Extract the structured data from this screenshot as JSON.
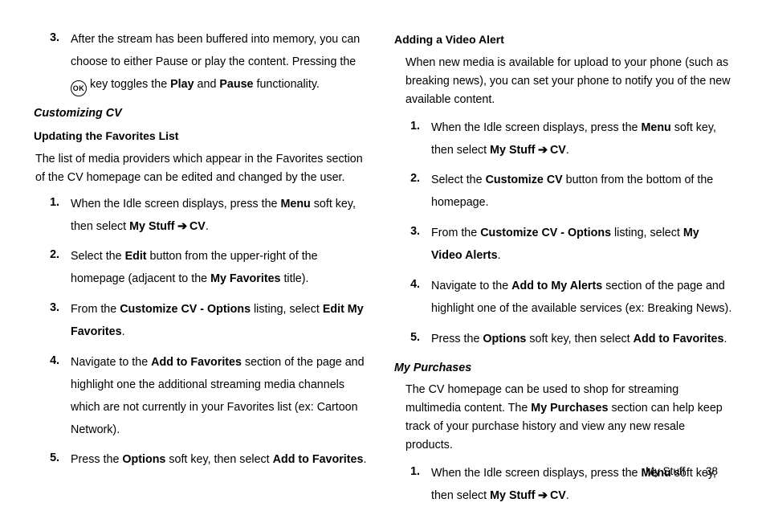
{
  "left": {
    "prior_step_num": "3.",
    "prior_step_text_a": "After the stream has been buffered into memory, you can choose to either Pause or play the content. Pressing the ",
    "prior_step_text_b": " key toggles the ",
    "prior_step_play": "Play",
    "prior_step_and": " and ",
    "prior_step_pause": "Pause",
    "prior_step_text_c": " functionality.",
    "h1": "Customizing CV",
    "h1_sub": "Updating the Favorites List",
    "intro": "The list of media providers which appear in the Favorites section of the CV homepage can be edited and changed by the user.",
    "steps": [
      {
        "n": "1.",
        "pre": "When the Idle screen displays, press the ",
        "b1": "Menu",
        "mid1": " soft key, then select ",
        "b2": "My Stuff",
        "arrow": " ➔ ",
        "b3": "CV",
        "tail": "."
      },
      {
        "n": "2.",
        "pre": "Select the ",
        "b1": "Edit",
        "mid1": " button from the upper-right of the homepage (adjacent to the ",
        "b2": "My Favorites",
        "mid2": " title).",
        "b3": "",
        "arrow": "",
        "tail": ""
      },
      {
        "n": "3.",
        "pre": "From the ",
        "b1": "Customize CV - Options",
        "mid1": " listing, select ",
        "b2": "Edit My Favorites",
        "mid2": ".",
        "b3": "",
        "arrow": "",
        "tail": ""
      },
      {
        "n": "4.",
        "pre": "Navigate to the ",
        "b1": "Add to Favorites",
        "mid1": " section of the page and highlight one the additional streaming media channels which are not currently in your Favorites list (ex: Cartoon Network).",
        "b2": "",
        "mid2": "",
        "b3": "",
        "arrow": "",
        "tail": ""
      },
      {
        "n": "5.",
        "pre": "Press the ",
        "b1": "Options",
        "mid1": " soft key, then select ",
        "b2": "Add to Favorites",
        "mid2": ".",
        "b3": "",
        "arrow": "",
        "tail": ""
      }
    ]
  },
  "right": {
    "h_sub": "Adding a Video Alert",
    "intro": "When new media is available for upload to your phone (such as breaking news), you can set your phone to notify you of the new available content.",
    "steps": [
      {
        "n": "1.",
        "pre": "When the Idle screen displays, press the ",
        "b1": "Menu",
        "mid1": " soft key, then select ",
        "b2": "My Stuff",
        "arrow": " ➔ ",
        "b3": "CV",
        "tail": "."
      },
      {
        "n": "2.",
        "pre": "Select the ",
        "b1": "Customize CV",
        "mid1": " button from the bottom of the homepage.",
        "b2": "",
        "mid2": "",
        "b3": "",
        "arrow": "",
        "tail": ""
      },
      {
        "n": "3.",
        "pre": "From the ",
        "b1": "Customize CV - Options",
        "mid1": " listing, select ",
        "b2": "My Video Alerts",
        "mid2": ".",
        "b3": "",
        "arrow": "",
        "tail": ""
      },
      {
        "n": "4.",
        "pre": "Navigate to the ",
        "b1": "Add to My Alerts",
        "mid1": " section of the page and highlight one of the available services (ex: Breaking News).",
        "b2": "",
        "mid2": "",
        "b3": "",
        "arrow": "",
        "tail": ""
      },
      {
        "n": "5.",
        "pre": "Press the ",
        "b1": "Options",
        "mid1": " soft key, then select ",
        "b2": "Add to Favorites",
        "mid2": ".",
        "b3": "",
        "arrow": "",
        "tail": ""
      }
    ],
    "h2": "My Purchases",
    "intro2_a": "The CV homepage can be used to shop for streaming multimedia content. The ",
    "intro2_b": "My Purchases",
    "intro2_c": " section can help keep track of your purchase history and view any new resale products.",
    "steps2": [
      {
        "n": "1.",
        "pre": "When the Idle screen displays, press the ",
        "b1": "Menu",
        "mid1": " soft key, then select ",
        "b2": "My Stuff",
        "arrow": " ➔ ",
        "b3": "CV",
        "tail": "."
      }
    ]
  },
  "footer": {
    "section": "My Stuff",
    "page": "38"
  },
  "icons": {
    "ok": "OK"
  }
}
